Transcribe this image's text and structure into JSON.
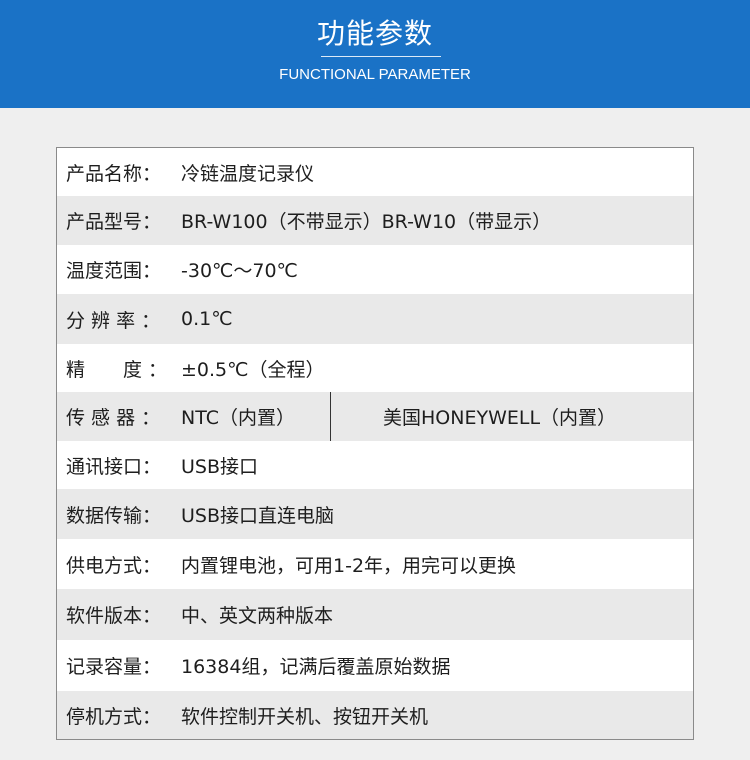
{
  "header": {
    "title": "功能参数",
    "subtitle": "FUNCTIONAL PARAMETER"
  },
  "colors": {
    "banner": "#1a72c6",
    "background": "#efefef",
    "row_shade": "#e9e9e9",
    "row_plain": "#ffffff",
    "border": "#8a8a8a"
  },
  "params": [
    {
      "label": "产品名称：",
      "value": "冷链温度记录仪"
    },
    {
      "label": "产品型号：",
      "value": "BR-W100（不带显示）BR-W10（带显示）"
    },
    {
      "label": "温度范围：",
      "value": "-30℃～70℃"
    },
    {
      "label": "分 辨 率 ：",
      "value": "0.1℃"
    },
    {
      "label": "精　　度 ：",
      "value": "±0.5℃（全程）"
    },
    {
      "label": "传 感 器 ：",
      "value": "NTC（内置）",
      "value2": "美国HONEYWELL（内置）"
    },
    {
      "label": "通讯接口：",
      "value": "USB接口"
    },
    {
      "label": "数据传输：",
      "value": "USB接口直连电脑"
    },
    {
      "label": "供电方式：",
      "value": "内置锂电池，可用1-2年，用完可以更换"
    },
    {
      "label": "软件版本：",
      "value": "中、英文两种版本"
    },
    {
      "label": "记录容量：",
      "value": "16384组，记满后覆盖原始数据"
    },
    {
      "label": "停机方式：",
      "value": "软件控制开关机、按钮开关机"
    }
  ]
}
